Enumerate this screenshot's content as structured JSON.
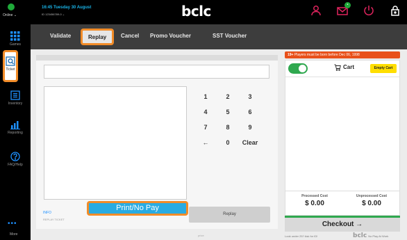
{
  "header": {
    "online_label": "Online ⌄",
    "datetime": "16:45 Tuesday 30 August",
    "terminal_id": "ID 123456789-0 ⌄",
    "logo": "bclc"
  },
  "sidebar": {
    "items": [
      {
        "label": "Games",
        "icon": "grid-icon"
      },
      {
        "label": "Ticket",
        "icon": "ticket-scan-icon"
      },
      {
        "label": "Inventory",
        "icon": "inventory-icon"
      },
      {
        "label": "Reporting",
        "icon": "bar-chart-icon"
      },
      {
        "label": "FAQ/Help",
        "icon": "help-icon"
      }
    ],
    "more_label": "More"
  },
  "tabs": [
    "Validate",
    "Replay",
    "Cancel",
    "Promo Voucher",
    "SST Voucher"
  ],
  "keypad": [
    "1",
    "2",
    "3",
    "4",
    "5",
    "6",
    "7",
    "8",
    "9",
    "←",
    "0",
    "Clear"
  ],
  "main": {
    "info_label": "INFO",
    "info_sub": "REPLAY TICKET",
    "print_nopay_label": "Print/No Pay",
    "replay_label": "Replay",
    "footer_small": "prize"
  },
  "cart": {
    "age_banner_bold": "19+",
    "age_banner_text": " Players must be born before Dec 06, 1998",
    "title": "Cart",
    "empty_label": "Empty Cart",
    "processed_label": "Processed Cost",
    "processed_value": "$ 0.00",
    "unprocessed_label": "Unprocessed Cost",
    "unprocessed_value": "$ 0.00",
    "checkout_label": "Checkout →"
  },
  "bottom": {
    "left_note": "Look under 25? Ask for ID!",
    "right_logo": "bclc",
    "right_note": "No Play At Work"
  },
  "colors": {
    "accent_blue": "#29abe2",
    "highlight_orange": "#f28c28",
    "online_green": "#1faa3a",
    "top_icon_red": "#e0245e",
    "empty_cart_yellow": "#ffde00"
  }
}
